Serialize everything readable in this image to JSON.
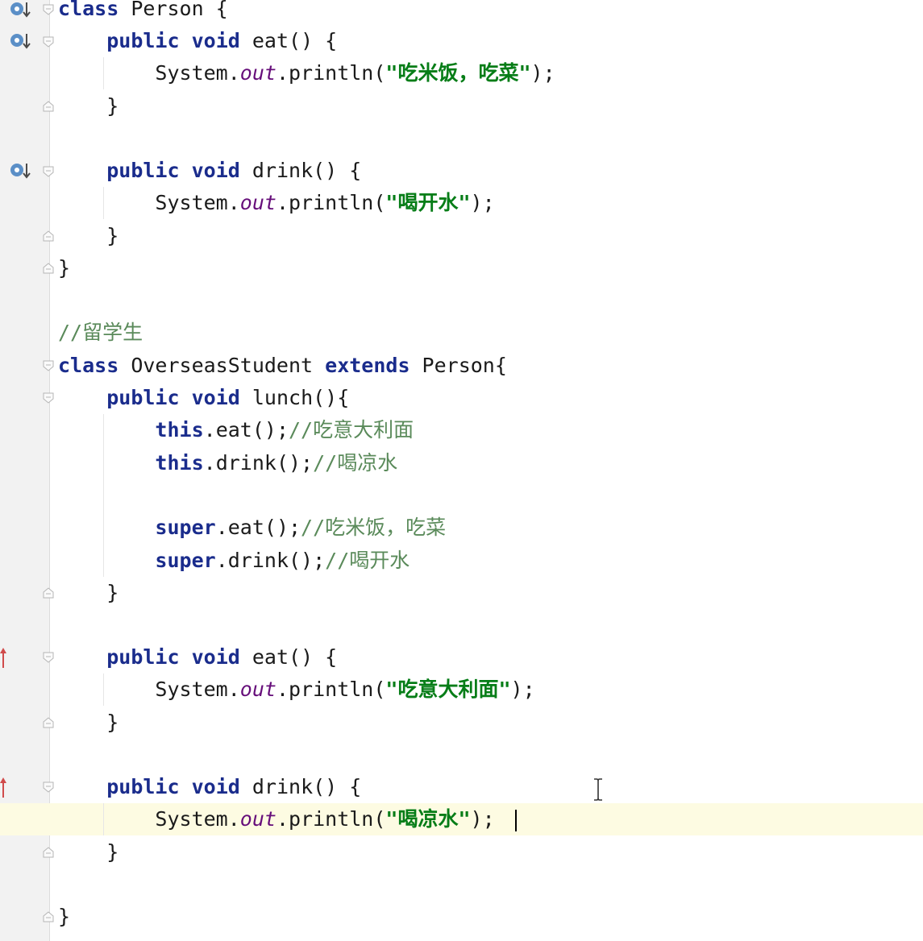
{
  "code": {
    "lines": {
      "l1": {
        "kw1": "class",
        "t1": " Person {"
      },
      "l2": {
        "indent": "    ",
        "kw1": "public",
        "sp1": " ",
        "kw2": "void",
        "t1": " eat() {"
      },
      "l3": {
        "indent": "        ",
        "t1": "System.",
        "field": "out",
        "t2": ".println(",
        "str": "\"吃米饭，吃菜\"",
        "t3": ");"
      },
      "l4": {
        "t1": "    }"
      },
      "l6": {
        "indent": "    ",
        "kw1": "public",
        "sp1": " ",
        "kw2": "void",
        "t1": " drink() {"
      },
      "l7": {
        "indent": "        ",
        "t1": "System.",
        "field": "out",
        "t2": ".println(",
        "str": "\"喝开水\"",
        "t3": ");"
      },
      "l8": {
        "t1": "    }"
      },
      "l9": {
        "t1": "}"
      },
      "l11": {
        "cmt": "//留学生"
      },
      "l12": {
        "kw1": "class",
        "t1": " OverseasStudent ",
        "kw2": "extends",
        "t2": " Person{"
      },
      "l13": {
        "indent": "    ",
        "kw1": "public",
        "sp1": " ",
        "kw2": "void",
        "t1": " lunch(){"
      },
      "l14": {
        "indent": "        ",
        "kw1": "this",
        "t1": ".eat();",
        "cmt": "//吃意大利面"
      },
      "l15": {
        "indent": "        ",
        "kw1": "this",
        "t1": ".drink();",
        "cmt": "//喝凉水"
      },
      "l17": {
        "indent": "        ",
        "kw1": "super",
        "t1": ".eat();",
        "cmt": "//吃米饭，吃菜"
      },
      "l18": {
        "indent": "        ",
        "kw1": "super",
        "t1": ".drink();",
        "cmt": "//喝开水"
      },
      "l19": {
        "t1": "    }"
      },
      "l21": {
        "indent": "    ",
        "kw1": "public",
        "sp1": " ",
        "kw2": "void",
        "t1": " eat() {"
      },
      "l22": {
        "indent": "        ",
        "t1": "System.",
        "field": "out",
        "t2": ".println(",
        "str": "\"吃意大利面\"",
        "t3": ");"
      },
      "l23": {
        "t1": "    }"
      },
      "l25": {
        "indent": "    ",
        "kw1": "public",
        "sp1": " ",
        "kw2": "void",
        "t1": " drink() {"
      },
      "l26": {
        "indent": "        ",
        "t1": "System.",
        "field": "out",
        "t2": ".println(",
        "str": "\"喝凉水\"",
        "t3": ");"
      },
      "l27": {
        "t1": "    }"
      },
      "l29": {
        "t1": "}"
      }
    }
  },
  "colors": {
    "keyword": "#1a2c8c",
    "field": "#660e7a",
    "string": "#067d17",
    "comment": "#5a8a5a",
    "gutter": "#f2f2f2",
    "current_line": "#fdfbe2"
  },
  "icons": {
    "override": "implements-method-icon",
    "overriding": "overrides-method-icon",
    "fold": "code-fold-icon"
  }
}
